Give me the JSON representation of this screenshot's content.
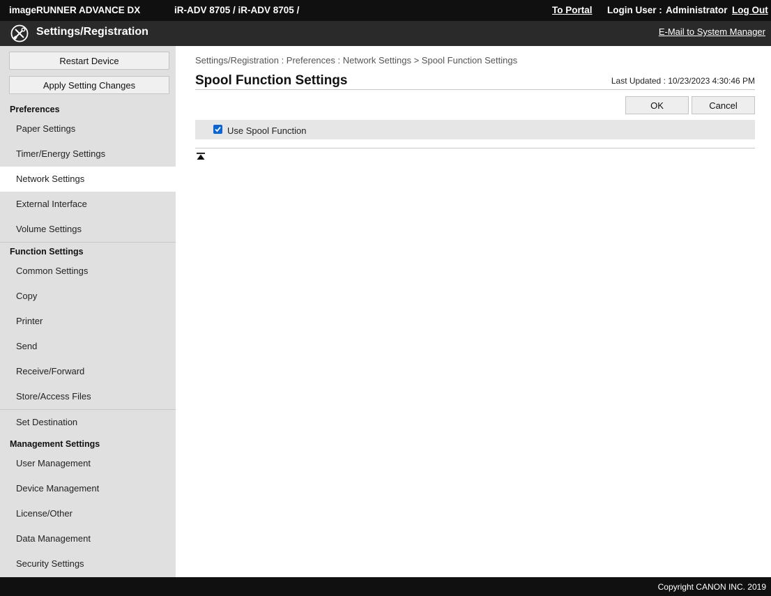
{
  "header": {
    "product": "imageRUNNER ADVANCE DX",
    "device": "iR-ADV 8705 / iR-ADV 8705 /",
    "portal_link": "To Portal",
    "login_label": "Login User :",
    "login_user": "Administrator",
    "logout_link": "Log Out"
  },
  "titlebar": {
    "icon": "settings-tools-icon",
    "title": "Settings/Registration",
    "email_link": "E-Mail to System Manager"
  },
  "sidebar": {
    "restart_button": "Restart Device",
    "apply_button": "Apply Setting Changes",
    "sections": [
      {
        "title": "Preferences",
        "items": [
          "Paper Settings",
          "Timer/Energy Settings",
          "Network Settings",
          "External Interface",
          "Volume Settings"
        ]
      },
      {
        "title": "Function Settings",
        "items": [
          "Common Settings",
          "Copy",
          "Printer",
          "Send",
          "Receive/Forward",
          "Store/Access Files",
          "Set Destination"
        ]
      },
      {
        "title": "Management Settings",
        "items": [
          "User Management",
          "Device Management",
          "License/Other",
          "Data Management",
          "Security Settings"
        ]
      }
    ],
    "active_item": "Network Settings"
  },
  "main": {
    "breadcrumb": "Settings/Registration : Preferences : Network Settings > Spool Function Settings",
    "heading": "Spool Function Settings",
    "last_updated": "Last Updated : 10/23/2023 4:30:46 PM",
    "ok_button": "OK",
    "cancel_button": "Cancel",
    "option_label": "Use Spool Function",
    "option_checked": true,
    "back_to_top_icon": "back-to-top-icon"
  },
  "footer": {
    "copyright": "Copyright CANON INC. 2019"
  },
  "colors": {
    "topbar": "#101010",
    "titlebar": "#2a2a2a",
    "sidebar": "#e0e0e0",
    "checkbox": "#0a66d6"
  }
}
